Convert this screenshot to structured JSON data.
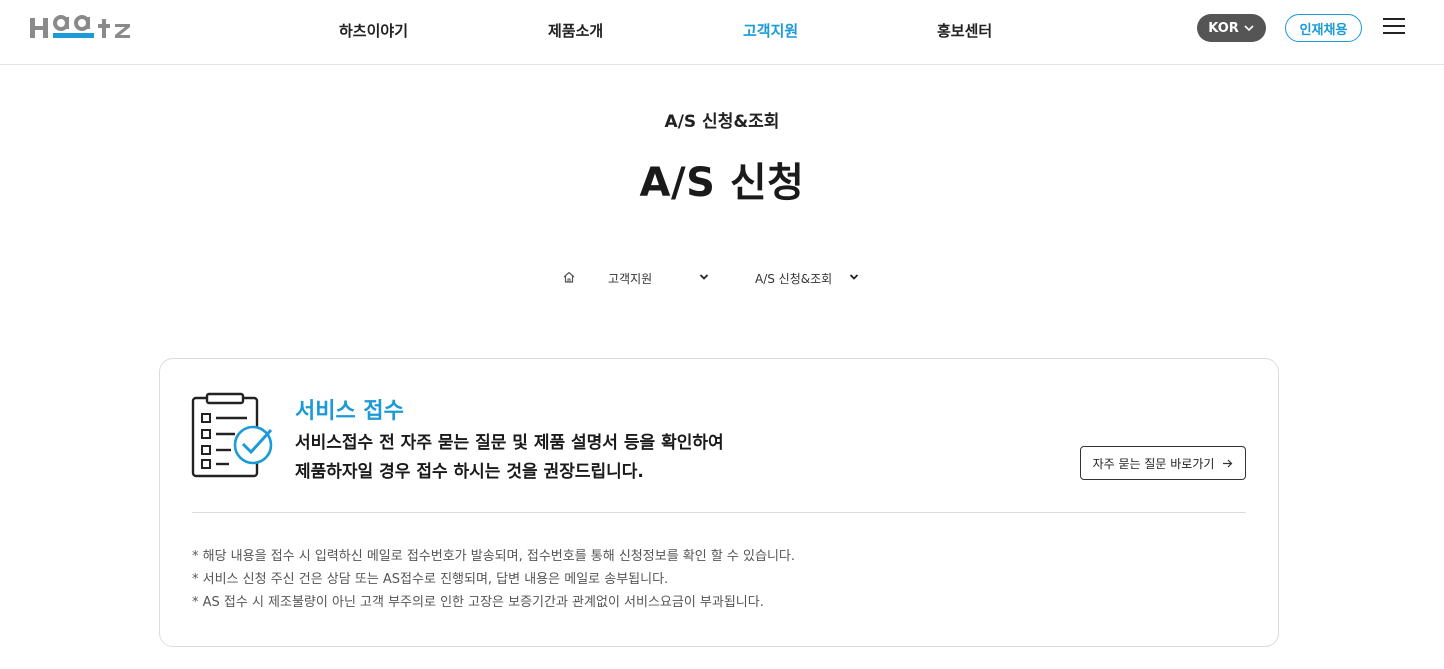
{
  "header": {
    "logo_alt": "Haatz",
    "nav": [
      {
        "label": "하츠이야기",
        "active": false
      },
      {
        "label": "제품소개",
        "active": false
      },
      {
        "label": "고객지원",
        "active": true
      },
      {
        "label": "홍보센터",
        "active": false
      }
    ],
    "lang_label": "KOR",
    "recruit_label": "인재채용"
  },
  "page": {
    "subtitle": "A/S 신청&조회",
    "title": "A/S 신청"
  },
  "breadcrumb": {
    "items": [
      "고객지원",
      "A/S 신청&조회"
    ]
  },
  "card": {
    "heading": "서비스 접수",
    "desc_lines": [
      "서비스접수 전 자주 묻는 질문 및 제품 설명서 등을 확인하여",
      "제품하자일 경우 접수 하시는 것을 권장드립니다."
    ],
    "faq_button": "자주 묻는 질문 바로가기",
    "notes": [
      "* 해당 내용을 접수 시 입력하신 메일로 접수번호가 발송되며, 접수번호를 통해 신청정보를 확인 할 수 있습니다.",
      "* 서비스 신청 주신 건은 상담 또는 AS접수로 진행되며, 답변 내용은 메일로 송부됩니다.",
      "* AS 접수 시 제조불량이 아닌 고객 부주의로 인한 고장은 보증기간과 관계없이 서비스요금이 부과됩니다."
    ]
  },
  "colors": {
    "accent": "#1a9ad6",
    "logo_gray": "#8a8a8a",
    "lang_bg": "#555555"
  }
}
